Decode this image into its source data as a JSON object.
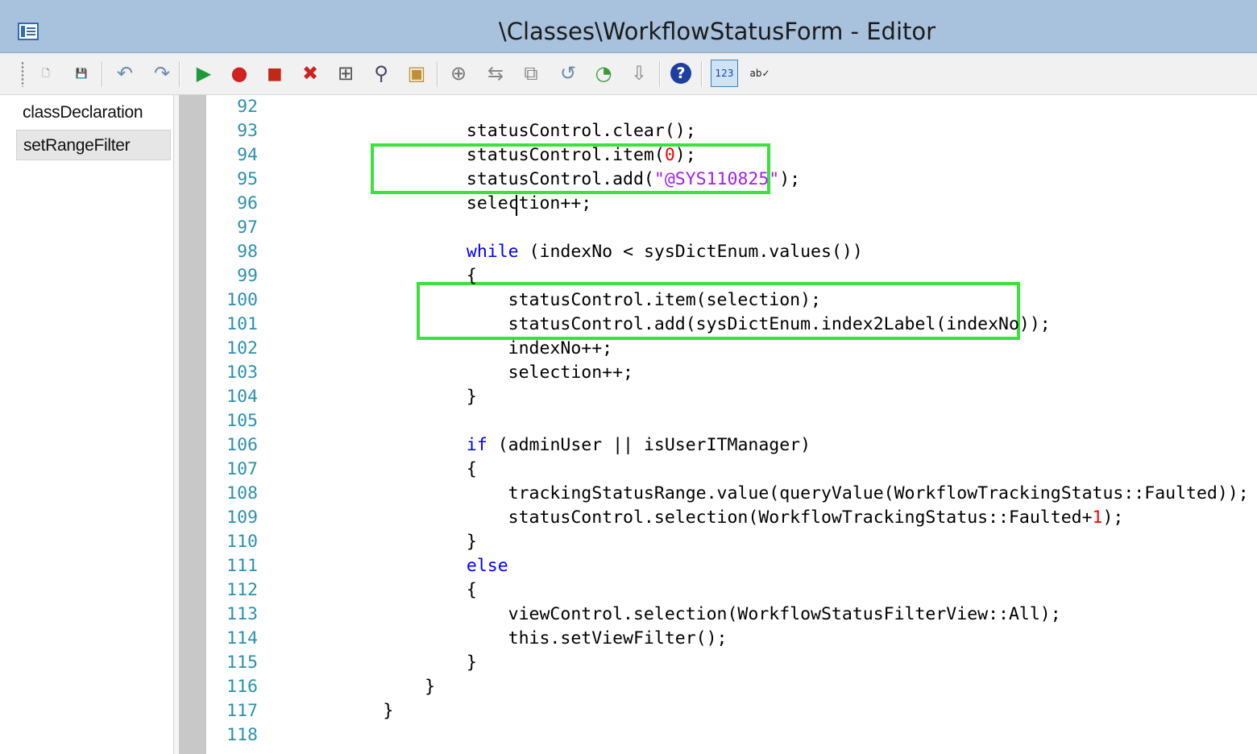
{
  "window": {
    "title": "\\Classes\\WorkflowStatusForm - Editor"
  },
  "toolbar": {
    "buttons": [
      {
        "name": "new",
        "icon": "new-document-icon",
        "glyph": "🗋"
      },
      {
        "name": "save",
        "icon": "save-icon",
        "glyph": "💾"
      },
      {
        "name": "undo",
        "icon": "undo-icon",
        "glyph": "↶"
      },
      {
        "name": "redo",
        "icon": "redo-icon",
        "glyph": "↷"
      },
      {
        "name": "run",
        "icon": "run-icon",
        "glyph": "▶"
      },
      {
        "name": "breakpoint",
        "icon": "breakpoint-icon",
        "glyph": "●"
      },
      {
        "name": "enable-breakpoint",
        "icon": "breakpoint-toggle-icon",
        "glyph": "◼"
      },
      {
        "name": "remove-breakpoints",
        "icon": "remove-breakpoints-icon",
        "glyph": "✖"
      },
      {
        "name": "compile",
        "icon": "compile-icon",
        "glyph": "⊞"
      },
      {
        "name": "lookup",
        "icon": "lookup-icon",
        "glyph": "⚲"
      },
      {
        "name": "script",
        "icon": "script-icon",
        "glyph": "▣"
      },
      {
        "name": "add-to-project",
        "icon": "add-icon",
        "glyph": "⊕"
      },
      {
        "name": "compare",
        "icon": "compare-icon",
        "glyph": "⇆"
      },
      {
        "name": "history",
        "icon": "history-icon",
        "glyph": "⧉"
      },
      {
        "name": "revert",
        "icon": "revert-icon",
        "glyph": "↺"
      },
      {
        "name": "check-in",
        "icon": "check-in-icon",
        "glyph": "◔"
      },
      {
        "name": "check-out",
        "icon": "check-out-icon",
        "glyph": "⇩"
      },
      {
        "name": "help",
        "icon": "help-icon",
        "glyph": "?"
      },
      {
        "name": "line-numbers",
        "icon": "line-numbers-icon",
        "glyph": "123"
      },
      {
        "name": "spell",
        "icon": "spell-check-icon",
        "glyph": "ab✓"
      }
    ]
  },
  "methods": [
    {
      "label": "classDeclaration",
      "selected": false
    },
    {
      "label": "setRangeFilter",
      "selected": true
    }
  ],
  "colors": {
    "keyword": "#0000ff",
    "number": "#ff0000",
    "string": "#a020f0",
    "line_number": "#2b91af",
    "highlight_box": "#39e23d"
  },
  "code_lines": [
    {
      "n": "92",
      "t": ""
    },
    {
      "n": "93",
      "t": "            statusControl.clear();"
    },
    {
      "n": "94",
      "t": "            statusControl.item(<n>0</n>);"
    },
    {
      "n": "95",
      "t": "            statusControl.add(<s>\"@SYS110825\"</s>);"
    },
    {
      "n": "96",
      "t": "            selection++;"
    },
    {
      "n": "97",
      "t": ""
    },
    {
      "n": "98",
      "t": "            <k>while</k> (indexNo < sysDictEnum.values())"
    },
    {
      "n": "99",
      "t": "            {"
    },
    {
      "n": "100",
      "t": "                statusControl.item(selection);"
    },
    {
      "n": "101",
      "t": "                statusControl.add(sysDictEnum.index2Label(indexNo));"
    },
    {
      "n": "102",
      "t": "                indexNo++;"
    },
    {
      "n": "103",
      "t": "                selection++;"
    },
    {
      "n": "104",
      "t": "            }"
    },
    {
      "n": "105",
      "t": ""
    },
    {
      "n": "106",
      "t": "            <k>if</k> (adminUser || isUserITManager)"
    },
    {
      "n": "107",
      "t": "            {"
    },
    {
      "n": "108",
      "t": "                trackingStatusRange.value(queryValue(WorkflowTrackingStatus::Faulted));"
    },
    {
      "n": "109",
      "t": "                statusControl.selection(WorkflowTrackingStatus::Faulted+<n>1</n>);"
    },
    {
      "n": "110",
      "t": "            }"
    },
    {
      "n": "111",
      "t": "            <k>else</k>"
    },
    {
      "n": "112",
      "t": "            {"
    },
    {
      "n": "113",
      "t": "                viewControl.selection(WorkflowStatusFilterView::All);"
    },
    {
      "n": "114",
      "t": "                this.setViewFilter();"
    },
    {
      "n": "115",
      "t": "            }"
    },
    {
      "n": "116",
      "t": "        }"
    },
    {
      "n": "117",
      "t": "    }"
    },
    {
      "n": "118",
      "t": ""
    }
  ]
}
